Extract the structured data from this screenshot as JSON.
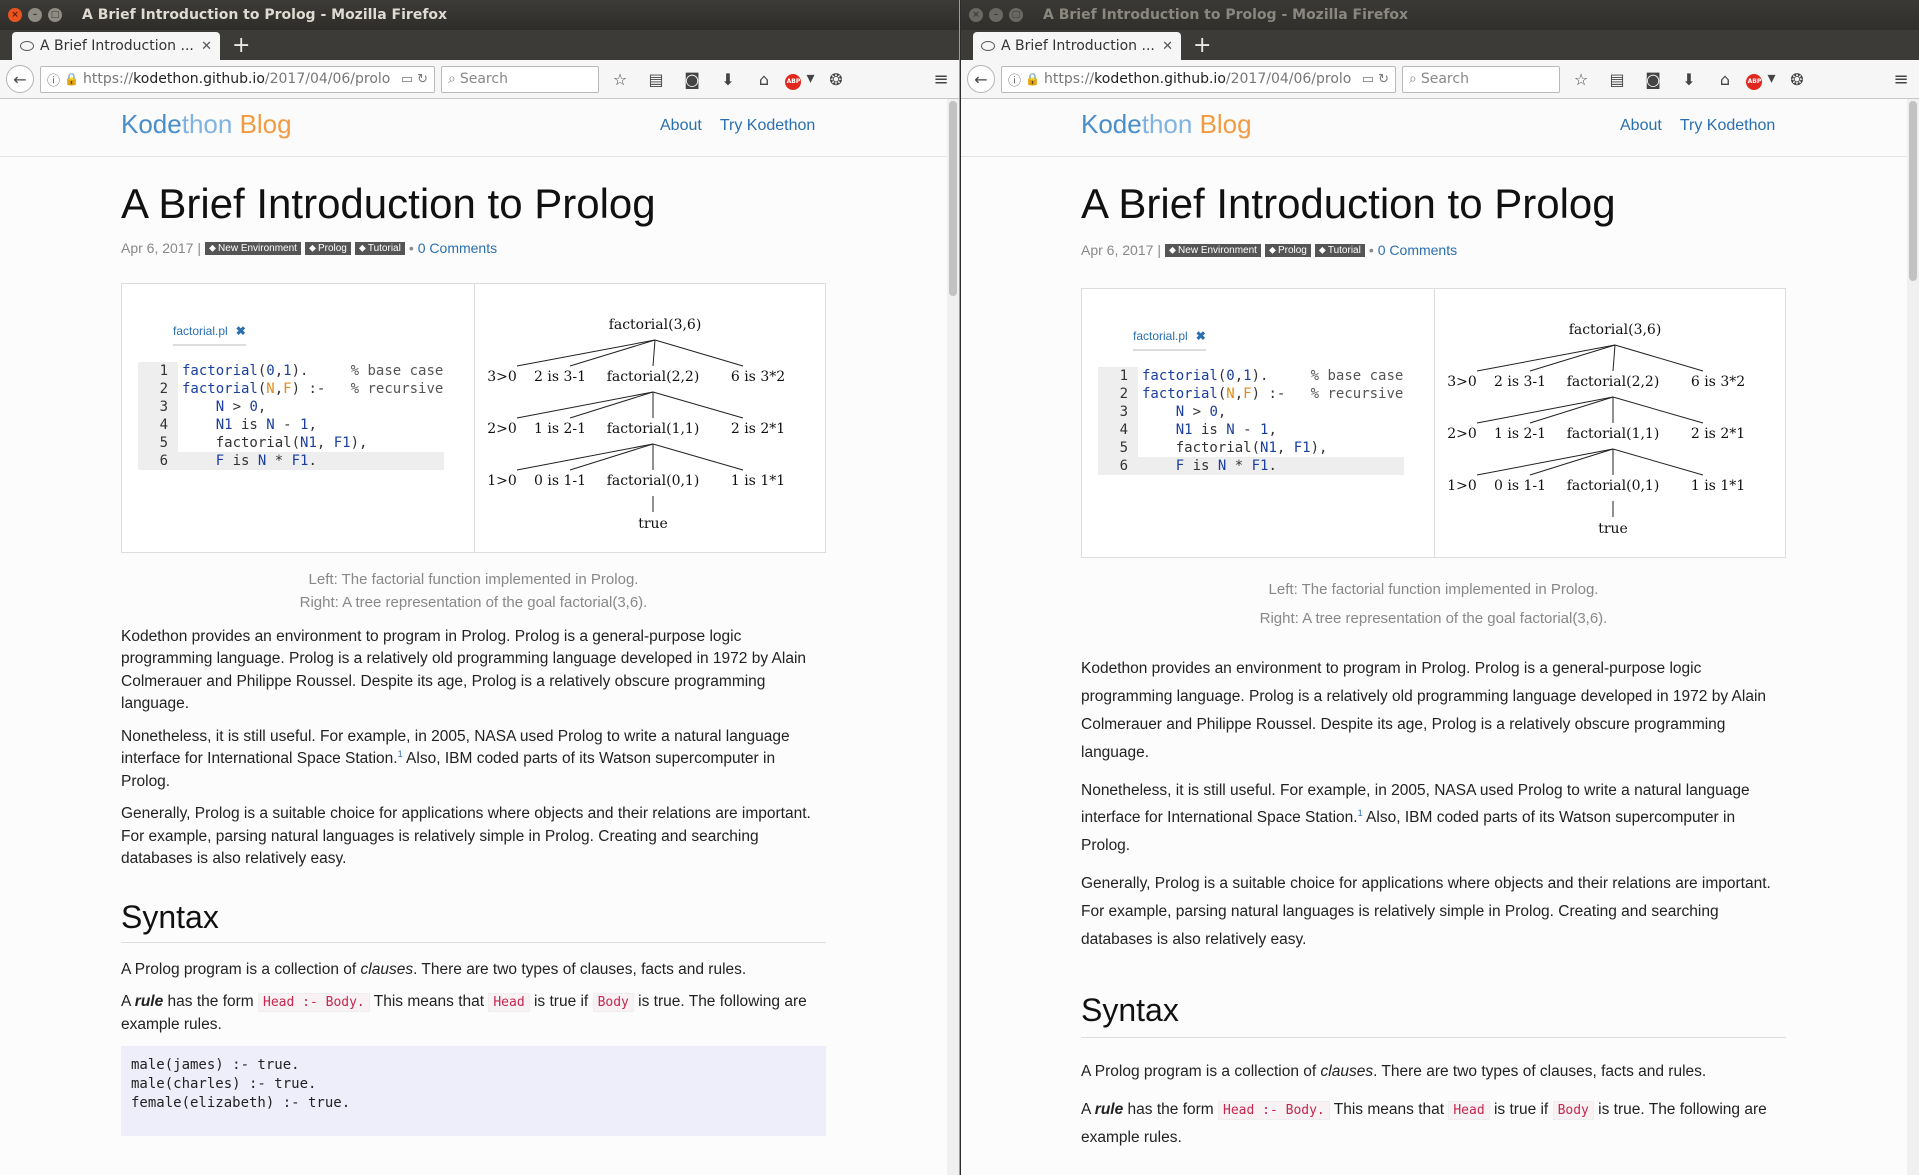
{
  "window": {
    "title": "A Brief Introduction to Prolog - Mozilla Firefox",
    "tab_label": "A Brief Introduction ...",
    "new_tab": "+",
    "url_scheme": "https://",
    "url_host": "kodethon.github.io",
    "url_path": "/2017/04/06/prolo",
    "search_placeholder": "Search"
  },
  "site": {
    "logo_part1": "Kode",
    "logo_part2": "thon",
    "logo_part3": " Blog",
    "nav": [
      "About",
      "Try Kodethon"
    ]
  },
  "post": {
    "title": "A Brief Introduction to Prolog",
    "date": "Apr 6, 2017",
    "sep": "|",
    "tags": [
      "New Environment",
      "Prolog",
      "Tutorial"
    ],
    "bullet": "•",
    "comments": "0 Comments",
    "figure": {
      "file_tab": "factorial.pl",
      "file_tab_close": "✖",
      "code": [
        {
          "n": "1",
          "text": "factorial(0,1).     % base case"
        },
        {
          "n": "2",
          "text": "factorial(N,F) :-   % recursive"
        },
        {
          "n": "3",
          "text": "    N > 0,"
        },
        {
          "n": "4",
          "text": "    N1 is N - 1,"
        },
        {
          "n": "5",
          "text": "    factorial(N1, F1),"
        },
        {
          "n": "6",
          "text": "    F is N * F1."
        }
      ],
      "tree": {
        "root": "factorial(3,6)",
        "level1": [
          "3>0",
          "2 is 3-1",
          "factorial(2,2)",
          "6 is 3*2"
        ],
        "level2": [
          "2>0",
          "1 is 2-1",
          "factorial(1,1)",
          "2 is 2*1"
        ],
        "level3": [
          "1>0",
          "0 is 1-1",
          "factorial(0,1)",
          "1 is 1*1"
        ],
        "leaf": "true"
      },
      "caption_line1": "Left: The factorial function implemented in Prolog.",
      "caption_line2": "Right: A tree representation of the goal factorial(3,6)."
    },
    "paragraphs": [
      "Kodethon provides an environment to program in Prolog. Prolog is a general-purpose logic programming language. Prolog is a relatively old programming language developed in 1972 by Alain Colmerauer and Philippe Roussel. Despite its age, Prolog is a relatively obscure programming language.",
      "Nonetheless, it is still useful. For example, in 2005, NASA used Prolog to write a natural language interface for International Space Station.",
      " Also, IBM coded parts of its Watson supercomputer in Prolog.",
      "Generally, Prolog is a suitable choice for applications where objects and their relations are important. For example, parsing natural languages is relatively simple in Prolog. Creating and searching databases is also relatively easy."
    ],
    "footnote": "1",
    "syntax_heading": "Syntax",
    "clauses_text_a": "A Prolog program is a collection of ",
    "clauses_em": "clauses",
    "clauses_text_b": ". There are two types of clauses, facts and rules.",
    "rule_a": "A ",
    "rule_em": "rule",
    "rule_b": " has the form ",
    "rule_code1": "Head :- Body.",
    "rule_c": " This means that ",
    "rule_code2": "Head",
    "rule_d": " is true if ",
    "rule_code3": "Body",
    "rule_e": " is true. The following are example rules.",
    "example_rules": [
      "male(james) :- true.",
      "male(charles) :- true.",
      "female(elizabeth) :- true."
    ]
  },
  "colors": {
    "link": "#2a6fb0",
    "logo_blue": "#4a8dc8",
    "logo_orange": "#f29b43",
    "ubuntu_close": "#e95420"
  }
}
